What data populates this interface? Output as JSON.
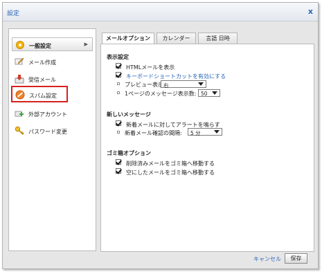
{
  "dialog": {
    "title": "設定",
    "close_label": "x"
  },
  "sidebar": {
    "items": [
      {
        "label": "一般設定",
        "icon": "gear-icon",
        "arrow": "▶"
      },
      {
        "label": "メール作成",
        "icon": "compose-icon"
      },
      {
        "label": "受信メール",
        "icon": "inbox-icon"
      },
      {
        "label": "スパム設定",
        "icon": "no-entry-icon"
      },
      {
        "label": "外部アカウント",
        "icon": "accounts-icon"
      },
      {
        "label": "パスワード変更",
        "icon": "key-icon"
      }
    ]
  },
  "tabs": [
    {
      "label": "メールオプション"
    },
    {
      "label": "カレンダー"
    },
    {
      "label": "言語 日時"
    }
  ],
  "display": {
    "heading": "表示設定",
    "show_html": "HTMLメールを表示",
    "enable_shortcuts": "キーボードショートカットを有効にする",
    "preview_label": "プレビュー表示:",
    "preview_value": "右",
    "per_page_label": "1ページのメッセージ表示数:",
    "per_page_value": "50"
  },
  "new_messages": {
    "heading": "新しいメッセージ",
    "alert": "新着メールに対してアラートを鳴らす",
    "interval_label": "新着メール確認の間隔:",
    "interval_value": "5 分"
  },
  "trash": {
    "heading": "ゴミ箱オプション",
    "move_deleted": "削除済みメールをゴミ箱へ移動する",
    "empty_to_trash": "空にしたメールをゴミ箱へ移動する"
  },
  "footer": {
    "cancel_label": "キャンセル",
    "save_label": "保存"
  },
  "colors": {
    "accent": "#2a66b8",
    "highlight": "#d62020"
  }
}
